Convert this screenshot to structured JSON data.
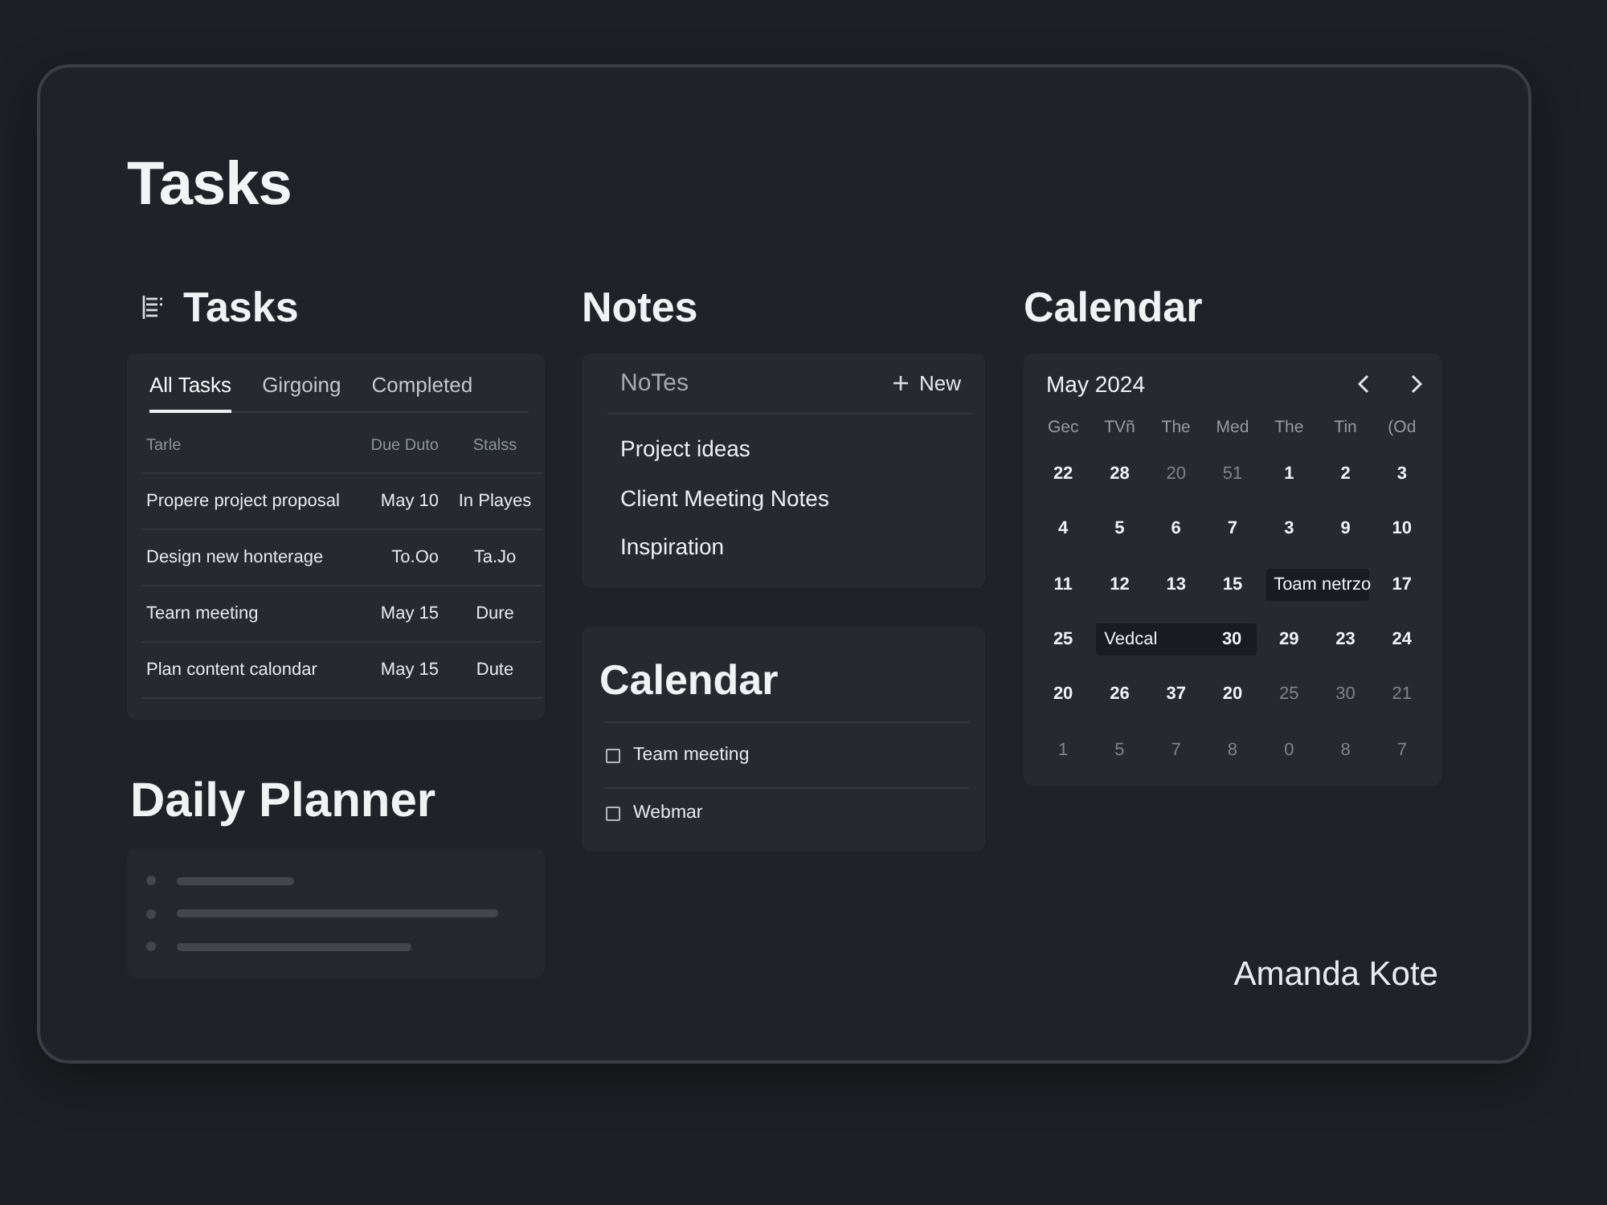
{
  "page": {
    "title": "Tasks"
  },
  "tasks": {
    "title": "Tasks",
    "tabs": [
      {
        "label": "All Tasks",
        "selected": true
      },
      {
        "label": "Girgoing",
        "selected": false
      },
      {
        "label": "Completed",
        "selected": false
      }
    ],
    "columns": [
      "Tarle",
      "Due Duto",
      "Stalss"
    ],
    "rows": [
      {
        "task": "Propere project proposal",
        "due": "May 10",
        "status": "In Playes"
      },
      {
        "task": "Design new honterage",
        "due": "To.Oo",
        "status": "Ta.Jo"
      },
      {
        "task": "Tearn meeting",
        "due": "May 15",
        "status": "Dure"
      },
      {
        "task": "Plan content calondar",
        "due": "May 15",
        "status": "Dute"
      }
    ]
  },
  "notes": {
    "title": "Notes",
    "list_title": "NoTes",
    "new_label": "New",
    "items": [
      "Project ideas",
      "Client Meeting Notes",
      "Inspiration"
    ]
  },
  "calendar": {
    "title": "Calendar",
    "month": "May 2024",
    "weekdays": [
      "Gec",
      "TVñ",
      "The",
      "Med",
      "The",
      "Tin",
      "(Od"
    ],
    "weeks": [
      [
        {
          "kind": "day",
          "day": "22",
          "muted": false
        },
        {
          "kind": "day",
          "day": "28",
          "muted": false
        },
        {
          "kind": "day",
          "day": "20",
          "muted": true
        },
        {
          "kind": "day",
          "day": "51",
          "muted": true
        },
        {
          "kind": "day",
          "day": "1",
          "muted": false
        },
        {
          "kind": "day",
          "day": "2",
          "muted": false
        },
        {
          "kind": "day",
          "day": "3",
          "muted": false
        }
      ],
      [
        {
          "kind": "day",
          "day": "4",
          "muted": false
        },
        {
          "kind": "day",
          "day": "5",
          "muted": false
        },
        {
          "kind": "day",
          "day": "6",
          "muted": false
        },
        {
          "kind": "day",
          "day": "7",
          "muted": false
        },
        {
          "kind": "day",
          "day": "3",
          "muted": false
        },
        {
          "kind": "day",
          "day": "9",
          "muted": false
        },
        {
          "kind": "day",
          "day": "10",
          "muted": false
        }
      ],
      [
        {
          "kind": "day",
          "day": "11",
          "muted": false
        },
        {
          "kind": "day",
          "day": "12",
          "muted": false
        },
        {
          "kind": "day",
          "day": "13",
          "muted": false
        },
        {
          "kind": "day",
          "day": "15",
          "muted": false
        },
        {
          "kind": "event",
          "label": "Toam netrzo"
        },
        {
          "kind": "day",
          "day": "17",
          "muted": false
        }
      ],
      [
        {
          "kind": "day",
          "day": "25",
          "muted": false
        },
        {
          "kind": "event",
          "label": "Vedcal",
          "day": "30"
        },
        {
          "kind": "day",
          "day": "29",
          "muted": false
        },
        {
          "kind": "day",
          "day": "23",
          "muted": false
        },
        {
          "kind": "day",
          "day": "24",
          "muted": false
        }
      ],
      [
        {
          "kind": "day",
          "day": "20",
          "muted": false
        },
        {
          "kind": "day",
          "day": "26",
          "muted": false
        },
        {
          "kind": "day",
          "day": "37",
          "muted": false
        },
        {
          "kind": "day",
          "day": "20",
          "muted": false
        },
        {
          "kind": "day",
          "day": "25",
          "muted": true
        },
        {
          "kind": "day",
          "day": "30",
          "muted": true
        },
        {
          "kind": "day",
          "day": "21",
          "muted": true
        }
      ],
      [
        {
          "kind": "day",
          "day": "1",
          "muted": true
        },
        {
          "kind": "day",
          "day": "5",
          "muted": true
        },
        {
          "kind": "day",
          "day": "7",
          "muted": true
        },
        {
          "kind": "day",
          "day": "8",
          "muted": true
        },
        {
          "kind": "day",
          "day": "0",
          "muted": true
        },
        {
          "kind": "day",
          "day": "8",
          "muted": true
        },
        {
          "kind": "day",
          "day": "7",
          "muted": true
        }
      ]
    ]
  },
  "daily_planner": {
    "title": "Daily Planner"
  },
  "agenda": {
    "title": "Calendar",
    "items": [
      {
        "label": "Team meeting",
        "checked": false
      },
      {
        "label": "Webmar",
        "checked": false
      }
    ]
  },
  "footer": {
    "user_name": "Amanda Kote"
  }
}
